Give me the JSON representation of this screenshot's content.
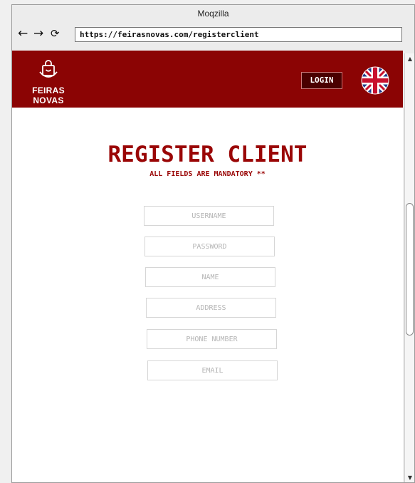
{
  "browser": {
    "title": "Moqzilla",
    "back_icon": "←",
    "forward_icon": "→",
    "reload_icon": "⟳",
    "url": "https://feirasnovas.com/registerclient",
    "scroll_up_icon": "▲",
    "scroll_down_icon": "▼"
  },
  "header": {
    "logo_text": "FEIRAS NOVAS",
    "login_label": "LOGIN",
    "language_flag": "uk-flag-icon",
    "brand_color": "#8b0404"
  },
  "form": {
    "title": "REGISTER CLIENT",
    "subtitle": "ALL FIELDS ARE MANDATORY **",
    "fields": [
      {
        "placeholder": "USERNAME",
        "value": ""
      },
      {
        "placeholder": "PASSWORD",
        "value": ""
      },
      {
        "placeholder": "NAME",
        "value": ""
      },
      {
        "placeholder": "ADDRESS",
        "value": ""
      },
      {
        "placeholder": "PHONE NUMBER",
        "value": ""
      },
      {
        "placeholder": "EMAIL",
        "value": ""
      }
    ]
  }
}
